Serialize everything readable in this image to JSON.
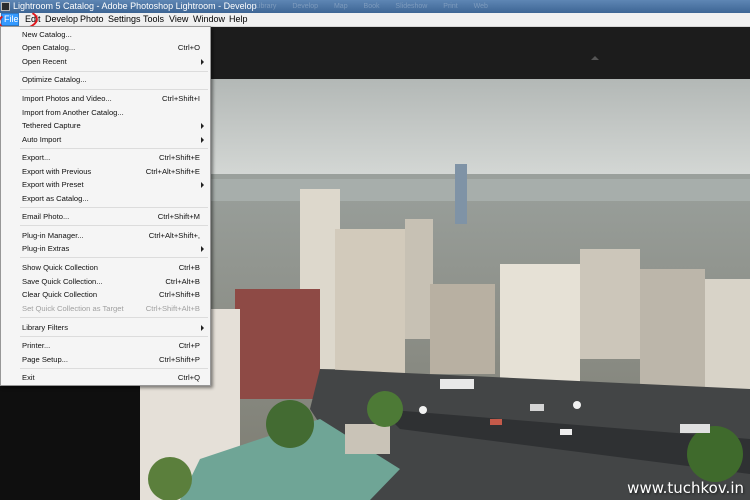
{
  "window": {
    "title": "Lightroom 5 Catalog - Adobe Photoshop Lightroom - Develop",
    "module_ghost": "Library Develop Map Book Slideshow Print Web"
  },
  "menubar": {
    "items": [
      "File",
      "Edit",
      "Develop",
      "Photo",
      "Settings",
      "Tools",
      "View",
      "Window",
      "Help"
    ],
    "active": "File"
  },
  "file_menu": {
    "items": [
      {
        "label": "New Catalog...",
        "shortcut": ""
      },
      {
        "label": "Open Catalog...",
        "shortcut": "Ctrl+O"
      },
      {
        "label": "Open Recent",
        "shortcut": "",
        "submenu": true
      },
      {
        "label": "Optimize Catalog...",
        "shortcut": ""
      },
      {
        "label": "Import Photos and Video...",
        "shortcut": "Ctrl+Shift+I"
      },
      {
        "label": "Import from Another Catalog...",
        "shortcut": ""
      },
      {
        "label": "Tethered Capture",
        "shortcut": "",
        "submenu": true
      },
      {
        "label": "Auto Import",
        "shortcut": "",
        "submenu": true
      },
      {
        "label": "Export...",
        "shortcut": "Ctrl+Shift+E"
      },
      {
        "label": "Export with Previous",
        "shortcut": "Ctrl+Alt+Shift+E"
      },
      {
        "label": "Export with Preset",
        "shortcut": "",
        "submenu": true
      },
      {
        "label": "Export as Catalog...",
        "shortcut": ""
      },
      {
        "label": "Email Photo...",
        "shortcut": "Ctrl+Shift+M"
      },
      {
        "label": "Plug-in Manager...",
        "shortcut": "Ctrl+Alt+Shift+,"
      },
      {
        "label": "Plug-in Extras",
        "shortcut": "",
        "submenu": true
      },
      {
        "label": "Show Quick Collection",
        "shortcut": "Ctrl+B"
      },
      {
        "label": "Save Quick Collection...",
        "shortcut": "Ctrl+Alt+B"
      },
      {
        "label": "Clear Quick Collection",
        "shortcut": "Ctrl+Shift+B"
      },
      {
        "label": "Set Quick Collection as Target",
        "shortcut": "Ctrl+Shift+Alt+B",
        "disabled": true
      },
      {
        "label": "Library Filters",
        "shortcut": "",
        "submenu": true
      },
      {
        "label": "Printer...",
        "shortcut": "Ctrl+P"
      },
      {
        "label": "Page Setup...",
        "shortcut": "Ctrl+Shift+P"
      },
      {
        "label": "Exit",
        "shortcut": "Ctrl+Q"
      }
    ]
  },
  "watermark": "www.tuchkov.in",
  "colors": {
    "titlebar": "#4a72a3",
    "menu_highlight": "#3399ff",
    "annotation": "#e0161b"
  }
}
